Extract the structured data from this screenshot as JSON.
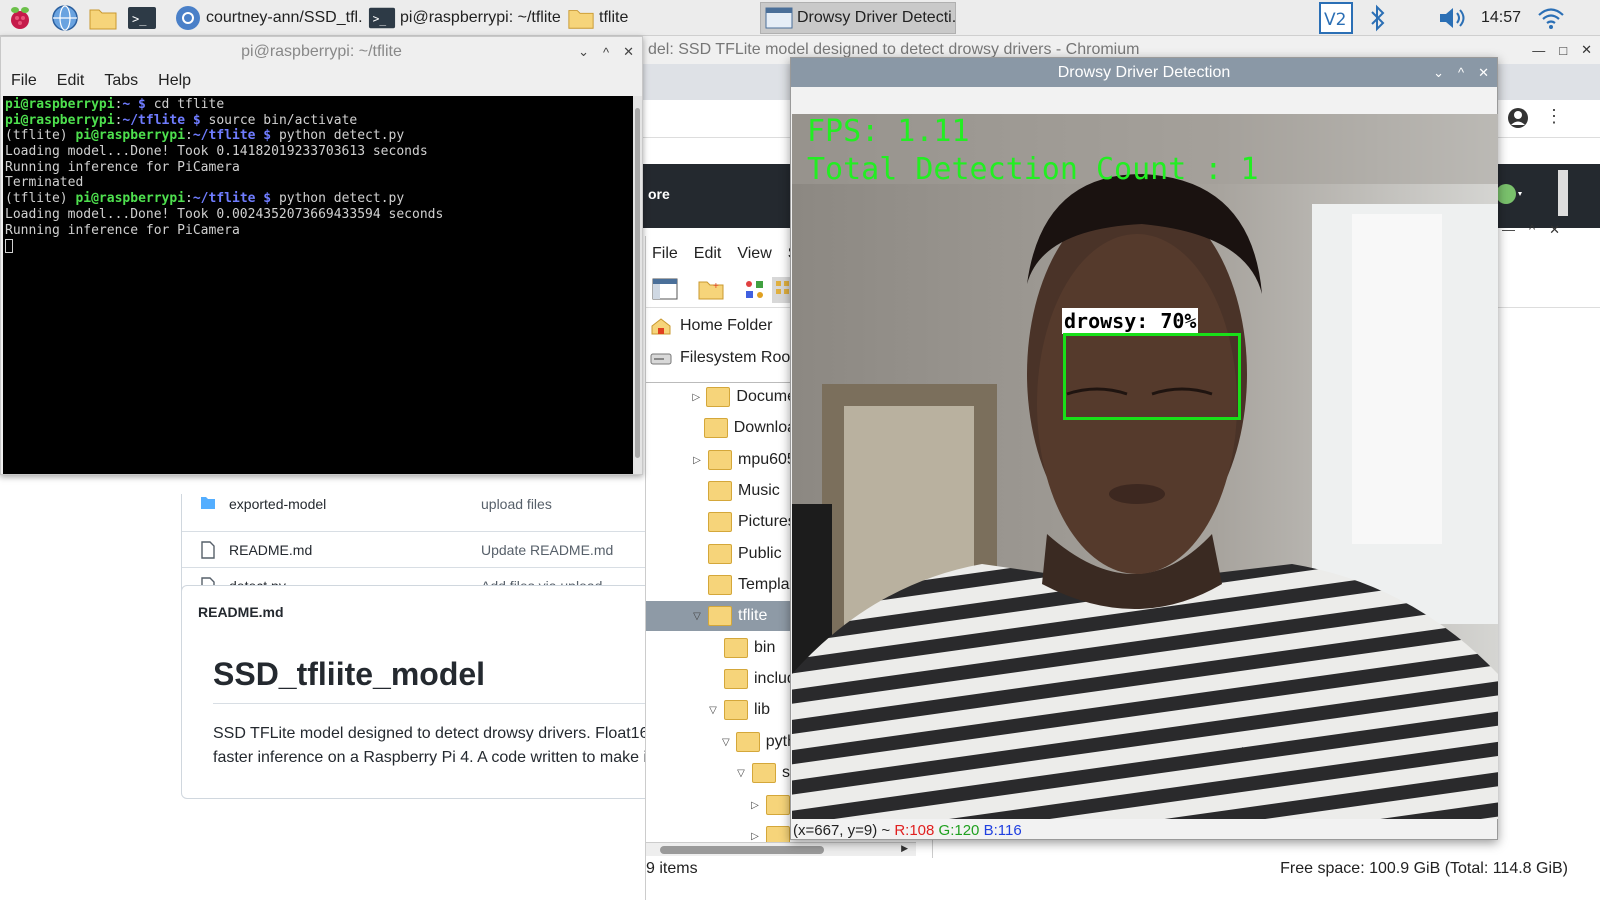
{
  "taskbar": {
    "tasks": [
      {
        "label": "courtney-ann/SSD_tfl..."
      },
      {
        "label": "pi@raspberrypi: ~/tflite"
      },
      {
        "label": "tflite"
      },
      {
        "label": "Drowsy Driver Detecti..."
      }
    ],
    "clock": "14:57",
    "icons": [
      "raspberry-menu-icon",
      "web-browser-icon",
      "file-manager-icon",
      "terminal-icon",
      "vnc-icon",
      "bluetooth-icon",
      "volume-icon",
      "wifi-icon"
    ]
  },
  "chromium": {
    "title": "del: SSD TFLite model designed to detect drowsy drivers - Chromium",
    "header_text": "ore",
    "files": [
      {
        "name": "exported-model",
        "message": "upload files"
      },
      {
        "name": "README.md",
        "message": "Update README.md"
      },
      {
        "name": "detect.py",
        "message": "Add files via upload"
      }
    ],
    "readme": {
      "header": "README.md",
      "title": "SSD_tfliite_model",
      "line1": "SSD TFLite model designed to detect drowsy drivers. Float16",
      "line2": "faster inference on a Raspberry Pi 4. A code written to make in"
    }
  },
  "file_manager": {
    "menu": [
      "File",
      "Edit",
      "View",
      "Sc"
    ],
    "places": [
      "Home Folder",
      "Filesystem Root"
    ],
    "tree": [
      {
        "label": "Docume",
        "icon": "documents-folder-icon",
        "expander": "right"
      },
      {
        "label": "Downloa",
        "icon": "downloads-folder-icon",
        "expander": ""
      },
      {
        "label": "mpu605",
        "icon": "folder-icon",
        "expander": "right"
      },
      {
        "label": "Music",
        "icon": "music-folder-icon",
        "expander": ""
      },
      {
        "label": "Pictures",
        "icon": "pictures-folder-icon",
        "expander": ""
      },
      {
        "label": "Public",
        "icon": "public-folder-icon",
        "expander": ""
      },
      {
        "label": "Templat",
        "icon": "templates-folder-icon",
        "expander": ""
      },
      {
        "label": "tflite",
        "icon": "folder-icon",
        "expander": "down"
      },
      {
        "label": "bin",
        "icon": "folder-icon",
        "expander": ""
      },
      {
        "label": "includ",
        "icon": "folder-icon",
        "expander": ""
      },
      {
        "label": "lib",
        "icon": "folder-icon",
        "expander": "down"
      },
      {
        "label": "pyth",
        "icon": "folder-icon",
        "expander": "down"
      },
      {
        "label": "si",
        "icon": "folder-icon",
        "expander": "down"
      },
      {
        "label": "",
        "icon": "folder-icon",
        "expander": "right"
      },
      {
        "label": "",
        "icon": "folder-icon",
        "expander": "right"
      }
    ],
    "status_items": "9 items",
    "status_space": "Free space: 100.9 GiB (Total: 114.8 GiB)"
  },
  "terminal": {
    "title": "pi@raspberrypi: ~/tflite",
    "menu": [
      "File",
      "Edit",
      "Tabs",
      "Help"
    ],
    "lines": [
      {
        "pre": "",
        "user": "pi@raspberrypi",
        "sep": ":",
        "path": "~ $",
        "cmd": " cd tflite"
      },
      {
        "pre": "",
        "user": "pi@raspberrypi",
        "sep": ":",
        "path": "~/tflite $",
        "cmd": " source bin/activate"
      },
      {
        "pre": "(tflite) ",
        "user": "pi@raspberrypi",
        "sep": ":",
        "path": "~/tflite $",
        "cmd": " python detect.py"
      },
      {
        "pre": "Loading model...Done! Took 0.14182019233703613 seconds",
        "user": "",
        "sep": "",
        "path": "",
        "cmd": ""
      },
      {
        "pre": "Running inference for PiCamera",
        "user": "",
        "sep": "",
        "path": "",
        "cmd": ""
      },
      {
        "pre": "Terminated",
        "user": "",
        "sep": "",
        "path": "",
        "cmd": ""
      },
      {
        "pre": "(tflite) ",
        "user": "pi@raspberrypi",
        "sep": ":",
        "path": "~/tflite $",
        "cmd": " python detect.py"
      },
      {
        "pre": "Loading model...Done! Took 0.0024352073669433594 seconds",
        "user": "",
        "sep": "",
        "path": "",
        "cmd": ""
      },
      {
        "pre": "Running inference for PiCamera",
        "user": "",
        "sep": "",
        "path": "",
        "cmd": ""
      }
    ]
  },
  "detector": {
    "title": "Drowsy Driver Detection",
    "fps": "FPS: 1.11",
    "count": "Total Detection Count : 1",
    "detection_label": "drowsy: 70%",
    "status_coords": "(x=667, y=9) ~",
    "status_r": "R:108",
    "status_g": "G:120",
    "status_b": "B:116"
  },
  "colors": {
    "overlay_green": "#22ee22",
    "box_green": "#19e019",
    "prompt_green": "#4ee04e",
    "prompt_blue": "#6f7cff",
    "titlebar_active": "#8a98a6"
  }
}
